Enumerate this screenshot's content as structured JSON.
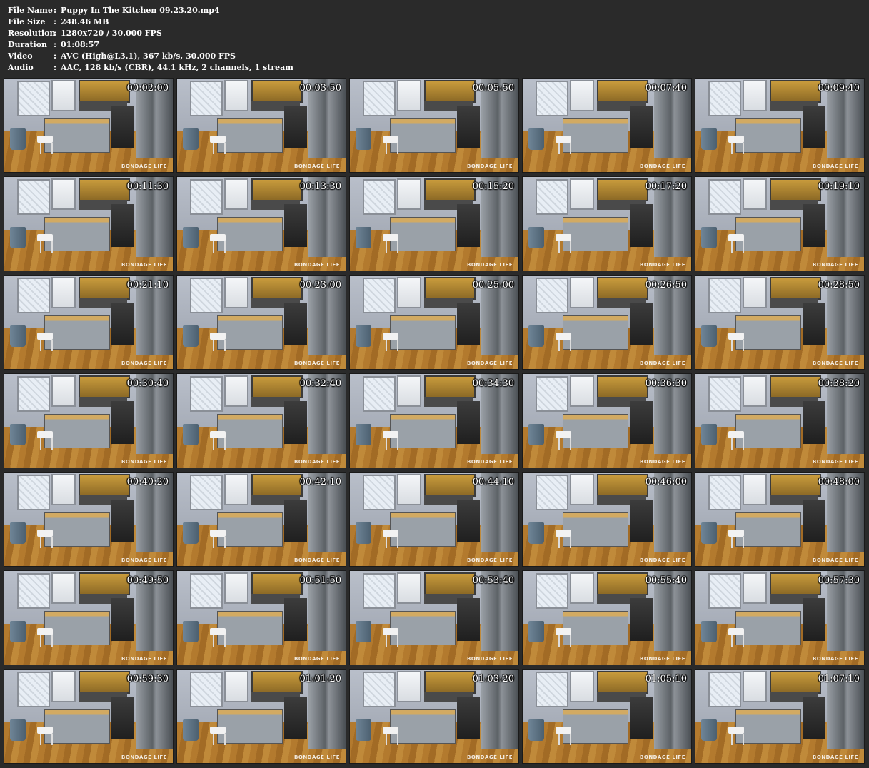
{
  "info": [
    {
      "key": "File Name",
      "sep": ":",
      "value": "Puppy In The Kitchen 09.23.20.mp4"
    },
    {
      "key": "File Size",
      "sep": ":",
      "value": "248.46 MB"
    },
    {
      "key": "Resolution",
      "sep": ":",
      "value": "1280x720 / 30.000 FPS"
    },
    {
      "key": "Duration",
      "sep": ":",
      "value": "01:08:57"
    },
    {
      "key": "Video",
      "sep": ":",
      "value": "AVC (High@L3.1), 367 kb/s, 30.000 FPS"
    },
    {
      "key": "Audio",
      "sep": ":",
      "value": "AAC, 128 kb/s (CBR), 44.1 kHz, 2 channels, 1 stream"
    }
  ],
  "logo_text": "BONDAGE LIFE",
  "thumbnails": [
    "00:02:00",
    "00:03:50",
    "00:05:50",
    "00:07:40",
    "00:09:40",
    "00:11:30",
    "00:13:30",
    "00:15:20",
    "00:17:20",
    "00:19:10",
    "00:21:10",
    "00:23:00",
    "00:25:00",
    "00:26:50",
    "00:28:50",
    "00:30:40",
    "00:32:40",
    "00:34:30",
    "00:36:30",
    "00:38:20",
    "00:40:20",
    "00:42:10",
    "00:44:10",
    "00:46:00",
    "00:48:00",
    "00:49:50",
    "00:51:50",
    "00:53:40",
    "00:55:40",
    "00:57:30",
    "00:59:30",
    "01:01:20",
    "01:03:20",
    "01:05:10",
    "01:07:10"
  ]
}
